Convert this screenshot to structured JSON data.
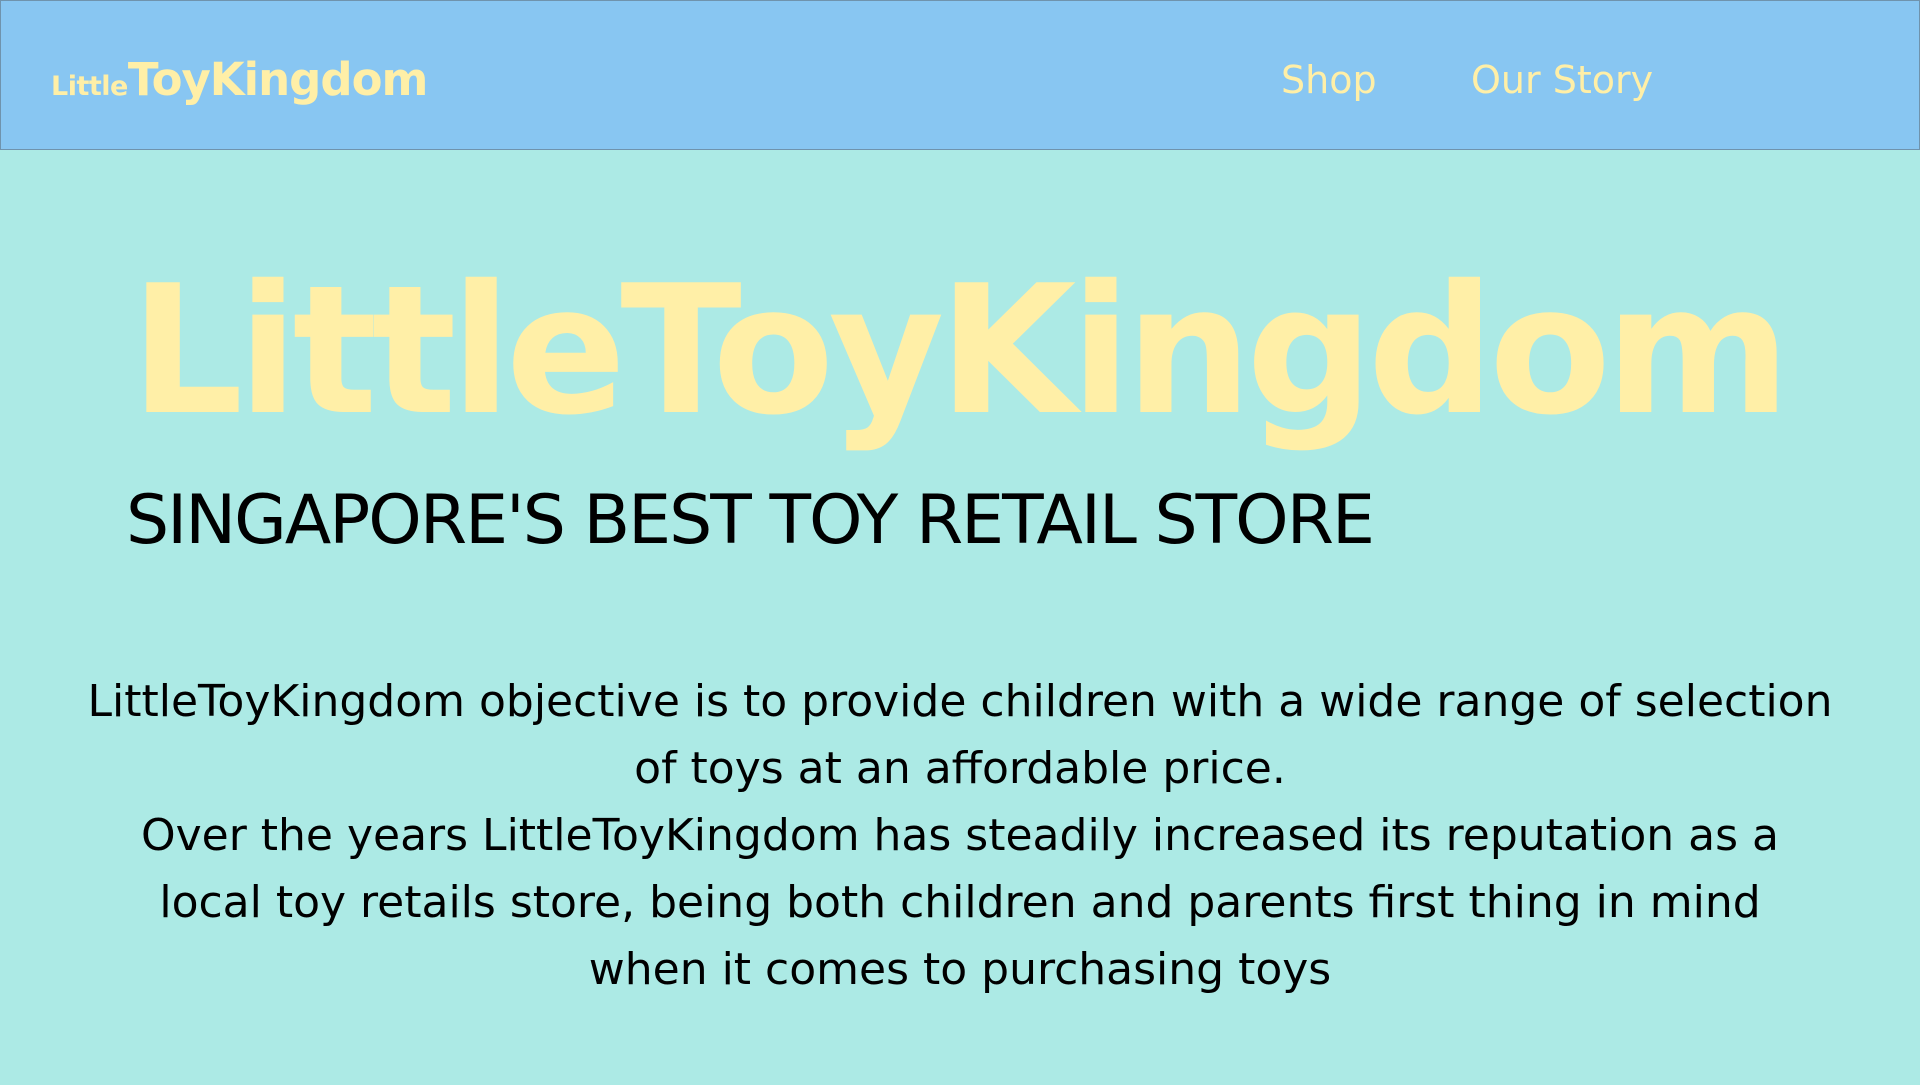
{
  "nav": {
    "brand_small": "Little",
    "brand_large": "ToyKingdom",
    "links": [
      "Shop",
      "Our Story"
    ]
  },
  "hero": {
    "title": "LittleToyKingdom",
    "subtitle": "SINGAPORE'S BEST TOY RETAIL STORE"
  },
  "description": {
    "lines": [
      "LittleToyKingdom objective is to provide children with a wide range of selection",
      "of  toys at an affordable price.",
      "Over the years LittleToyKingdom has steadily increased its reputation as a",
      "local toy retails store, being both children and parents first thing in mind",
      "when it comes to purchasing toys"
    ]
  },
  "colors": {
    "page_background": "#aceae5",
    "navbar_background": "#88c6f2",
    "accent_text": "#ffefa7",
    "body_text": "#000000"
  }
}
